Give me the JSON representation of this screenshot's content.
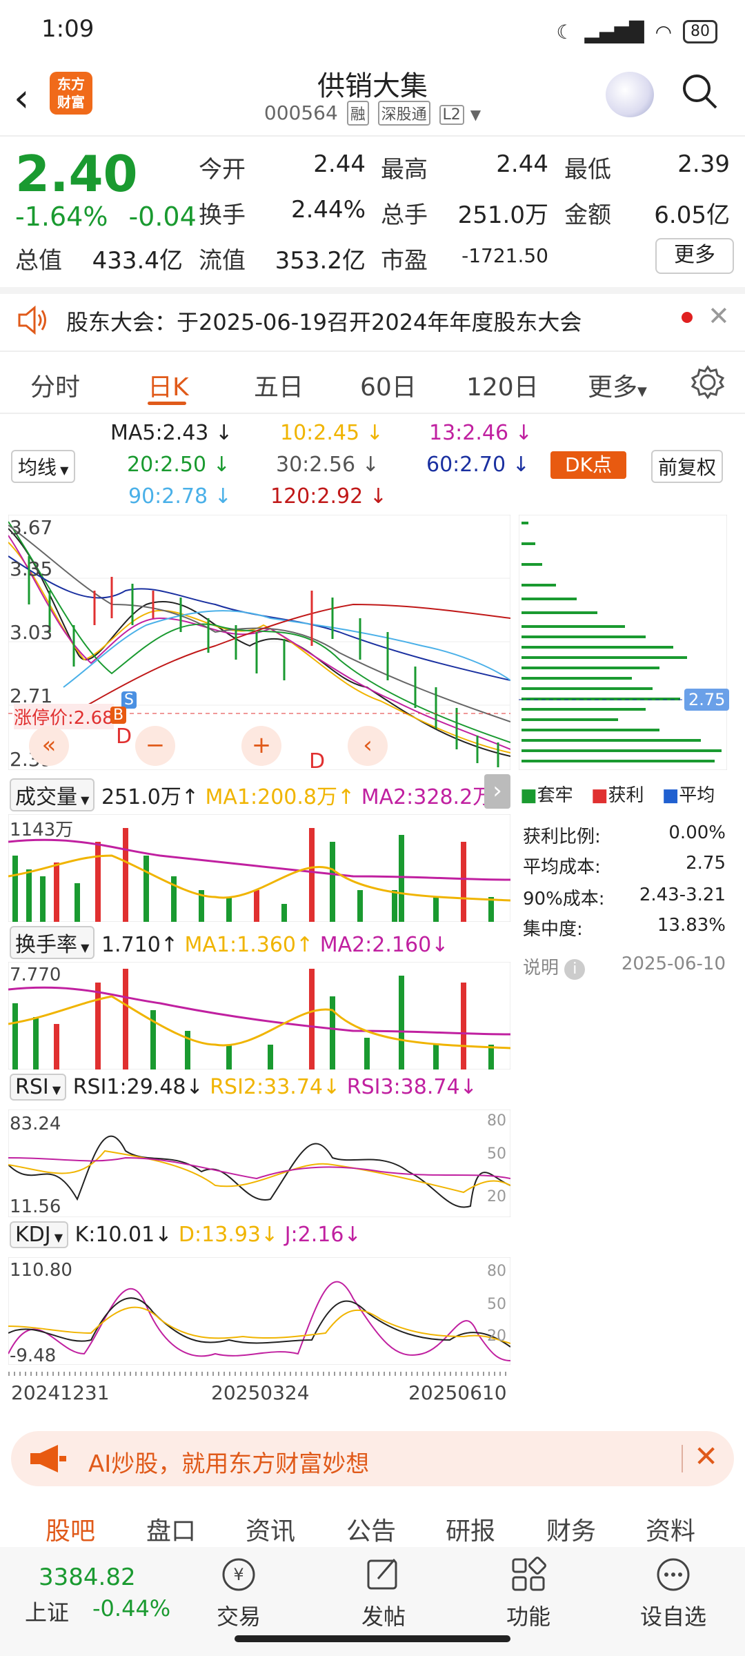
{
  "status": {
    "time": "1:09",
    "battery": "80"
  },
  "header": {
    "logo": "东方\n财富",
    "title": "供销大集",
    "code": "000564",
    "tags": [
      "融",
      "深股通",
      "L2"
    ]
  },
  "quote": {
    "price": "2.40",
    "pct": "-1.64%",
    "chg": "-0.04",
    "fields": [
      {
        "label": "今开",
        "value": "2.44"
      },
      {
        "label": "最高",
        "value": "2.44"
      },
      {
        "label": "最低",
        "value": "2.39"
      },
      {
        "label": "换手",
        "value": "2.44%"
      },
      {
        "label": "总手",
        "value": "251.0万"
      },
      {
        "label": "金额",
        "value": "6.05亿"
      },
      {
        "label": "总值",
        "value": "433.4亿"
      },
      {
        "label": "流值",
        "value": "353.2亿"
      },
      {
        "label": "市盈",
        "value": "-1721.50"
      }
    ],
    "more": "更多"
  },
  "notice": {
    "text": "股东大会：于2025-06-19召开2024年年度股东大会"
  },
  "tabs": [
    "分时",
    "日K",
    "五日",
    "60日",
    "120日",
    "更多"
  ],
  "ma": {
    "selector": "均线",
    "items": [
      {
        "label": "MA5:2.43",
        "color": "#222"
      },
      {
        "label": "10:2.45",
        "color": "#f0b400"
      },
      {
        "label": "13:2.46",
        "color": "#c020a0"
      },
      {
        "label": "20:2.50",
        "color": "#1a9a30"
      },
      {
        "label": "30:2.56",
        "color": "#555"
      },
      {
        "label": "60:2.70",
        "color": "#1a30a0"
      },
      {
        "label": "90:2.78",
        "color": "#4ab0e8"
      },
      {
        "label": "120:2.92",
        "color": "#c01818"
      }
    ],
    "dk": "DK点",
    "adjust": "前复权"
  },
  "kchart": {
    "ymax": "3.67",
    "y2": "3.35",
    "y3": "3.03",
    "y4": "2.71",
    "ymin": "2.39",
    "limit": "涨停价:2.68",
    "markers": [
      "S",
      "D",
      "D",
      "B"
    ]
  },
  "chip": {
    "avg": "2.75",
    "legend": [
      "套牢",
      "获利",
      "平均"
    ],
    "stats": [
      {
        "k": "获利比例:",
        "v": "0.00%"
      },
      {
        "k": "平均成本:",
        "v": "2.75"
      },
      {
        "k": "90%成本:",
        "v": "2.43-3.21"
      },
      {
        "k": "集中度:",
        "v": "13.83%"
      }
    ],
    "note": "说明",
    "date": "2025-06-10"
  },
  "vol": {
    "selector": "成交量",
    "cur": "251.0万",
    "ma1": "MA1:200.8万",
    "ma2": "MA2:328.2万",
    "ymax": "1143万"
  },
  "turn": {
    "selector": "换手率",
    "cur": "1.710",
    "ma1": "MA1:1.360",
    "ma2": "MA2:2.160",
    "ymax": "7.770"
  },
  "rsi": {
    "selector": "RSI",
    "r1": "RSI1:29.48",
    "r2": "RSI2:33.74",
    "r3": "RSI3:38.74",
    "ymax": "83.24",
    "ymin": "11.56",
    "lv": [
      "80",
      "50",
      "20"
    ]
  },
  "kdj": {
    "selector": "KDJ",
    "k": "K:10.01",
    "d": "D:13.93",
    "j": "J:2.16",
    "ymax": "110.80",
    "ymin": "-9.48",
    "lv": [
      "80",
      "50",
      "20"
    ]
  },
  "dates": [
    "20241231",
    "20250324",
    "20250610"
  ],
  "ad": {
    "text": "AI炒股，就用东方财富妙想"
  },
  "btabs": [
    "股吧",
    "盘口",
    "资讯",
    "公告",
    "研报",
    "财务",
    "资料"
  ],
  "index": {
    "value": "3384.82",
    "name": "上证",
    "pct": "-0.44%"
  },
  "bnav": [
    "交易",
    "发帖",
    "功能",
    "设自选"
  ]
}
